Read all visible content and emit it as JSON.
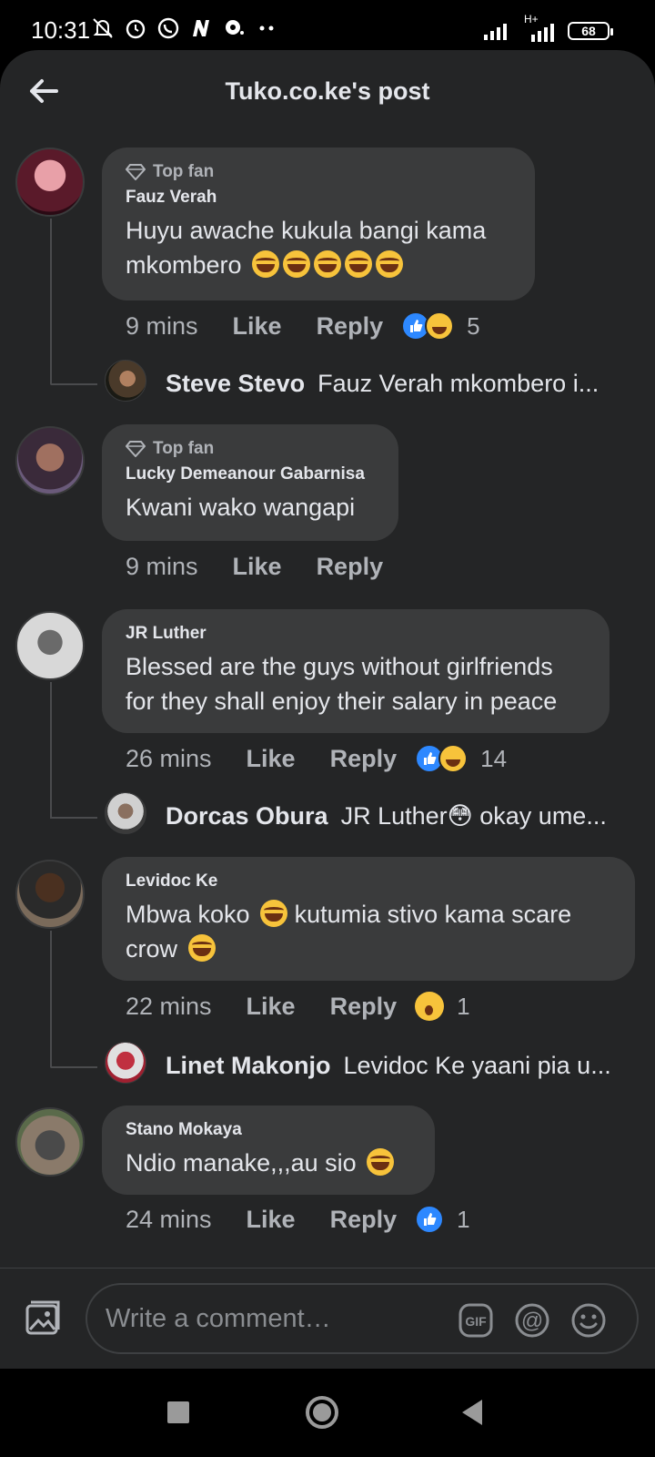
{
  "status_bar": {
    "time": "10:31",
    "network": "H+",
    "battery": "68"
  },
  "header": {
    "title": "Tuko.co.ke's post"
  },
  "comments": [
    {
      "badge": "Top fan",
      "author": "Fauz Verah",
      "line1": "Huyu awache kukula bangi kama",
      "line2": "mkombero",
      "emoji_count": 5,
      "time": "9 mins",
      "like": "Like",
      "reply": "Reply",
      "reactions": [
        "like",
        "haha"
      ],
      "reaction_count": "5",
      "reply_preview": {
        "name": "Steve Stevo",
        "text": "Fauz Verah mkombero i..."
      }
    },
    {
      "badge": "Top fan",
      "author": "Lucky Demeanour Gabarnisa",
      "line1": "Kwani wako wangapi",
      "time": "9 mins",
      "like": "Like",
      "reply": "Reply"
    },
    {
      "author": "JR Luther",
      "line1": "Blessed are the guys without girlfriends",
      "line2": "for they shall enjoy their salary in peace",
      "time": "26 mins",
      "like": "Like",
      "reply": "Reply",
      "reactions": [
        "like",
        "haha"
      ],
      "reaction_count": "14",
      "reply_preview": {
        "name": "Dorcas Obura",
        "text": "JR Luther😳 okay ume..."
      }
    },
    {
      "author": "Levidoc Ke",
      "line1a": "Mbwa koko",
      "line1b": "kutumia stivo kama scare",
      "line2": "crow",
      "time": "22 mins",
      "like": "Like",
      "reply": "Reply",
      "reactions": [
        "wow"
      ],
      "reaction_count": "1",
      "reply_preview": {
        "name": "Linet Makonjo",
        "text": "Levidoc Ke yaani pia u..."
      }
    },
    {
      "author": "Stano Mokaya",
      "line1": "Ndio manake,,,au sio",
      "time": "24 mins",
      "like": "Like",
      "reply": "Reply",
      "reactions": [
        "like"
      ],
      "reaction_count": "1"
    }
  ],
  "composer": {
    "placeholder": "Write a comment…",
    "gif_label": "GIF",
    "mention_label": "@"
  },
  "colors": {
    "background": "#242526",
    "bubble": "#3a3b3c",
    "text": "#e4e6eb",
    "muted": "#b0b3b8",
    "like_blue": "#2d88ff",
    "emoji_yellow": "#f7c33b"
  }
}
